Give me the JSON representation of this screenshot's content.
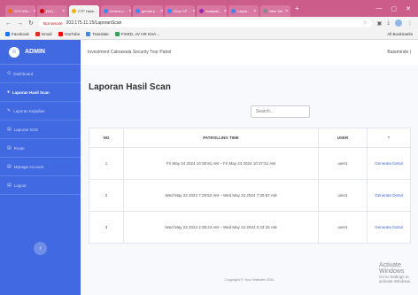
{
  "browser": {
    "tabs": [
      {
        "label": "SYS Wis…",
        "color": "#e8710a",
        "active": false
      },
      {
        "label": "(5/1)…",
        "color": "#c00",
        "active": false
      },
      {
        "label": "CTF Hack…",
        "color": "#f4b400",
        "active": true
      },
      {
        "label": "Kenesi p…",
        "color": "#4285f4",
        "active": false
      },
      {
        "label": "gemail p…",
        "color": "#4285f4",
        "active": false
      },
      {
        "label": "Drop CP…",
        "color": "#4285f4",
        "active": false
      },
      {
        "label": "Analysis…",
        "color": "#9c27b0",
        "active": false
      },
      {
        "label": "Lapsa…",
        "color": "#4285f4",
        "active": false
      },
      {
        "label": "New Tab",
        "color": "#888",
        "active": false
      }
    ],
    "not_secure": "Not secure",
    "url": "203.175.11.15/LaporanScan",
    "bookmarks": [
      {
        "label": "Facebook",
        "color": "#1877f2"
      },
      {
        "label": "Gmail",
        "color": "#d93025"
      },
      {
        "label": "YouTube",
        "color": "#ff0000"
      },
      {
        "label": "Translate",
        "color": "#4285f4"
      },
      {
        "label": "FIXED, AV HR KHA…",
        "color": "#34a853"
      }
    ],
    "all_bookmarks": "All Bookmarks"
  },
  "sidebar": {
    "brand": "ADMIN",
    "items": [
      {
        "label": "Dashboard",
        "icon": "dashboard-icon",
        "glyph": "⊙",
        "active": false
      },
      {
        "label": "Laporan Hasil Scan",
        "icon": "scan-icon",
        "glyph": "●",
        "active": true
      },
      {
        "label": "Laporan Kejadian",
        "icon": "pencil-icon",
        "glyph": "✎",
        "active": false
      },
      {
        "label": "Laporan SOS",
        "icon": "sos-icon",
        "glyph": "▤",
        "active": false
      },
      {
        "label": "Route",
        "icon": "route-icon",
        "glyph": "▤",
        "active": false
      },
      {
        "label": "Manage Account",
        "icon": "account-icon",
        "glyph": "▤",
        "active": false
      },
      {
        "label": "Logout",
        "icon": "logout-icon",
        "glyph": "▤",
        "active": false
      }
    ]
  },
  "topbar": {
    "title": "Investment Cakrawala Security Tour Patrol",
    "user": "Batamindo |"
  },
  "main": {
    "page_title": "Laporan Hasil Scan",
    "search_placeholder": "Search...",
    "columns": [
      "NO",
      "PATROLLING TIME",
      "USER",
      "*"
    ],
    "rows": [
      {
        "no": "1",
        "time": "Fri May 24 2024 10:36:91 AM – Fri May 24 2024 10:37:51 AM",
        "user": "user1",
        "action": "Generate Detail"
      },
      {
        "no": "2",
        "time": "Wed May 22 2024 7:29:52 AM – Wed May 22 2024 7:30:57 AM",
        "user": "user1",
        "action": "Generate Detail"
      },
      {
        "no": "3",
        "time": "Wed May 22 2024 2:39:24 AM – Wed May 22 2024 2:43:34 AM",
        "user": "user1",
        "action": "Generate Detail"
      }
    ],
    "footer": "Copyright © Your Website 2024"
  },
  "windows_watermark": {
    "line1": "Activate Windows",
    "line2": "Go to Settings to activate Windows."
  },
  "colors": {
    "sidebar": "#4169e1",
    "tabbar": "#cc5c8a",
    "link": "#4169e1"
  }
}
